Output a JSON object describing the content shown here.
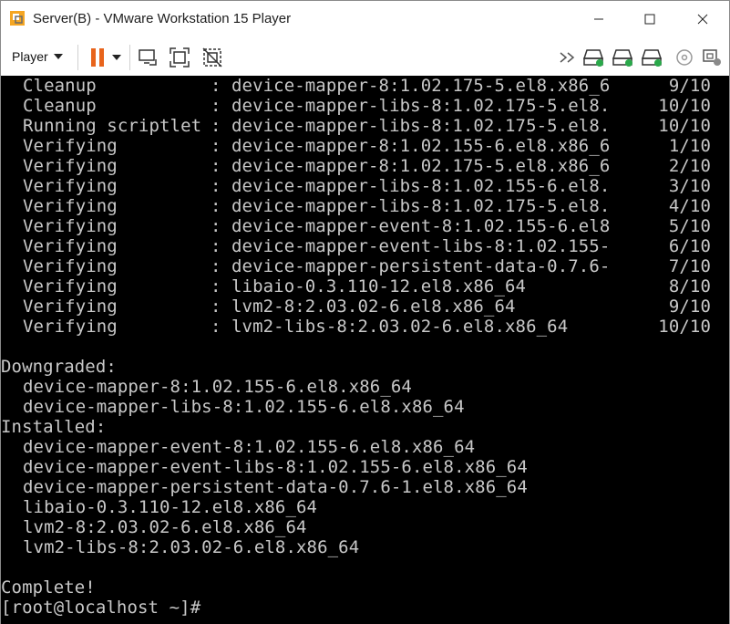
{
  "window": {
    "title": "Server(B) - VMware Workstation 15 Player"
  },
  "toolbar": {
    "player_label": "Player"
  },
  "console": {
    "transaction_rows": [
      {
        "action": "Cleanup",
        "package": "device-mapper-8:1.02.175-5.el8.x86_6",
        "count": "9/10"
      },
      {
        "action": "Cleanup",
        "package": "device-mapper-libs-8:1.02.175-5.el8.",
        "count": "10/10"
      },
      {
        "action": "Running scriptlet",
        "package": "device-mapper-libs-8:1.02.175-5.el8.",
        "count": "10/10"
      },
      {
        "action": "Verifying",
        "package": "device-mapper-8:1.02.155-6.el8.x86_6",
        "count": "1/10"
      },
      {
        "action": "Verifying",
        "package": "device-mapper-8:1.02.175-5.el8.x86_6",
        "count": "2/10"
      },
      {
        "action": "Verifying",
        "package": "device-mapper-libs-8:1.02.155-6.el8.",
        "count": "3/10"
      },
      {
        "action": "Verifying",
        "package": "device-mapper-libs-8:1.02.175-5.el8.",
        "count": "4/10"
      },
      {
        "action": "Verifying",
        "package": "device-mapper-event-8:1.02.155-6.el8",
        "count": "5/10"
      },
      {
        "action": "Verifying",
        "package": "device-mapper-event-libs-8:1.02.155-",
        "count": "6/10"
      },
      {
        "action": "Verifying",
        "package": "device-mapper-persistent-data-0.7.6-",
        "count": "7/10"
      },
      {
        "action": "Verifying",
        "package": "libaio-0.3.110-12.el8.x86_64",
        "count": "8/10"
      },
      {
        "action": "Verifying",
        "package": "lvm2-8:2.03.02-6.el8.x86_64",
        "count": "9/10"
      },
      {
        "action": "Verifying",
        "package": "lvm2-libs-8:2.03.02-6.el8.x86_64",
        "count": "10/10"
      }
    ],
    "colon": ":",
    "downgraded_header": "Downgraded:",
    "downgraded": [
      "device-mapper-8:1.02.155-6.el8.x86_64",
      "device-mapper-libs-8:1.02.155-6.el8.x86_64"
    ],
    "installed_header": "Installed:",
    "installed": [
      "device-mapper-event-8:1.02.155-6.el8.x86_64",
      "device-mapper-event-libs-8:1.02.155-6.el8.x86_64",
      "device-mapper-persistent-data-0.7.6-1.el8.x86_64",
      "libaio-0.3.110-12.el8.x86_64",
      "lvm2-8:2.03.02-6.el8.x86_64",
      "lvm2-libs-8:2.03.02-6.el8.x86_64"
    ],
    "complete": "Complete!",
    "prompt": "[root@localhost ~]#"
  },
  "icons": {
    "app": "vmware-player-icon",
    "pause": "pause-icon",
    "send_ctrl_alt_del": "send-ctrl-alt-del-icon",
    "fit_guest": "fit-guest-icon",
    "unity": "unity-icon",
    "more_devices": "double-chevron-icon",
    "hdd1": "hard-disk-icon",
    "hdd2": "hard-disk-icon",
    "hdd3": "hard-disk-icon",
    "cd": "cd-dvd-icon",
    "network": "network-adapter-icon"
  },
  "colors": {
    "pause_orange": "#e8641c",
    "device_green": "#2aa84a",
    "console_text": "#c8c8c8",
    "console_bg": "#000000"
  }
}
